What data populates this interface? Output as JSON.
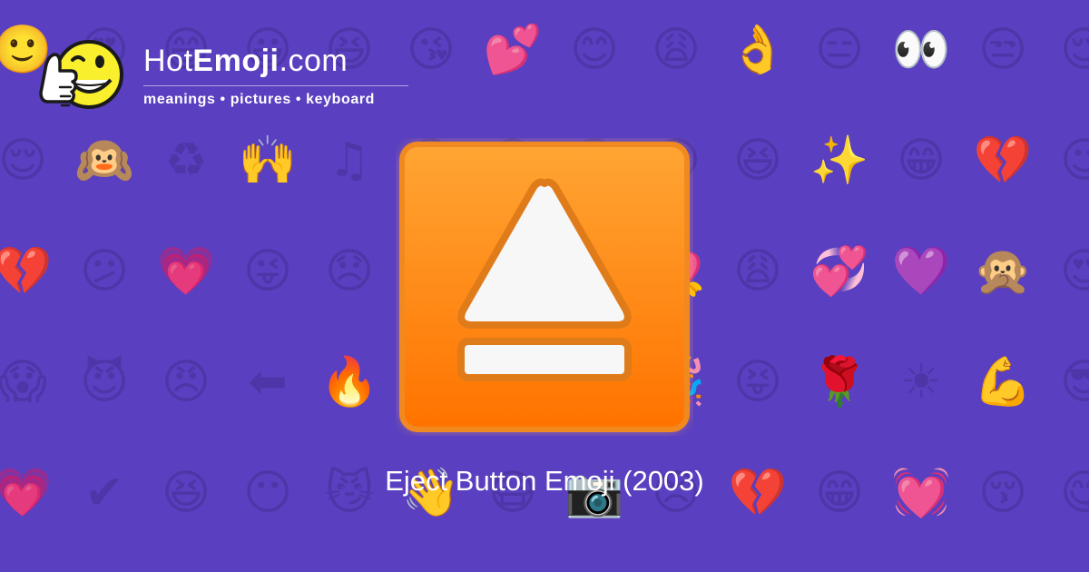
{
  "site": {
    "name_prefix": "Hot",
    "name_bold": "Emoji",
    "name_suffix": ".com",
    "tagline": "meanings • pictures • keyboard"
  },
  "emoji": {
    "icon": "eject-button-icon",
    "caption": "Eject Button Emoji (2003)",
    "colors": {
      "top": "#ffa533",
      "bottom": "#ff7300",
      "border": "#e07b1a",
      "symbol": "#f7f7f7"
    }
  },
  "background": {
    "color": "#5a3fc0",
    "pattern_color": "#4e36a8",
    "emoji_rows": [
      [
        "🙂",
        "😍",
        "😄",
        "😃",
        "😆",
        "😘",
        "💕",
        "😊",
        "😩",
        "👌",
        "😑",
        "👀",
        "😒",
        "😌"
      ],
      [
        "😌",
        "🙉",
        "♻",
        "🙌",
        "♫",
        "😂",
        "😊",
        "😑",
        "😢",
        "😆",
        "✨",
        "😁",
        "💔",
        "😉"
      ],
      [
        "💔",
        "😕",
        "💗",
        "😜",
        "😞",
        "😉",
        "😝",
        "😐",
        "💘",
        "😩",
        "💞",
        "💜",
        "🙊",
        "😍"
      ],
      [
        "😱",
        "😈",
        "😠",
        "⬅",
        "🔥",
        "😄",
        "😍",
        "😖",
        "🎉",
        "😝",
        "🌹",
        "☀",
        "💪",
        "😎"
      ],
      [
        "💗",
        "✔",
        "😆",
        "😶",
        "😼",
        "👋",
        "😷",
        "📷",
        "😣",
        "💔",
        "😁",
        "💓",
        "😚",
        "😋"
      ]
    ]
  }
}
